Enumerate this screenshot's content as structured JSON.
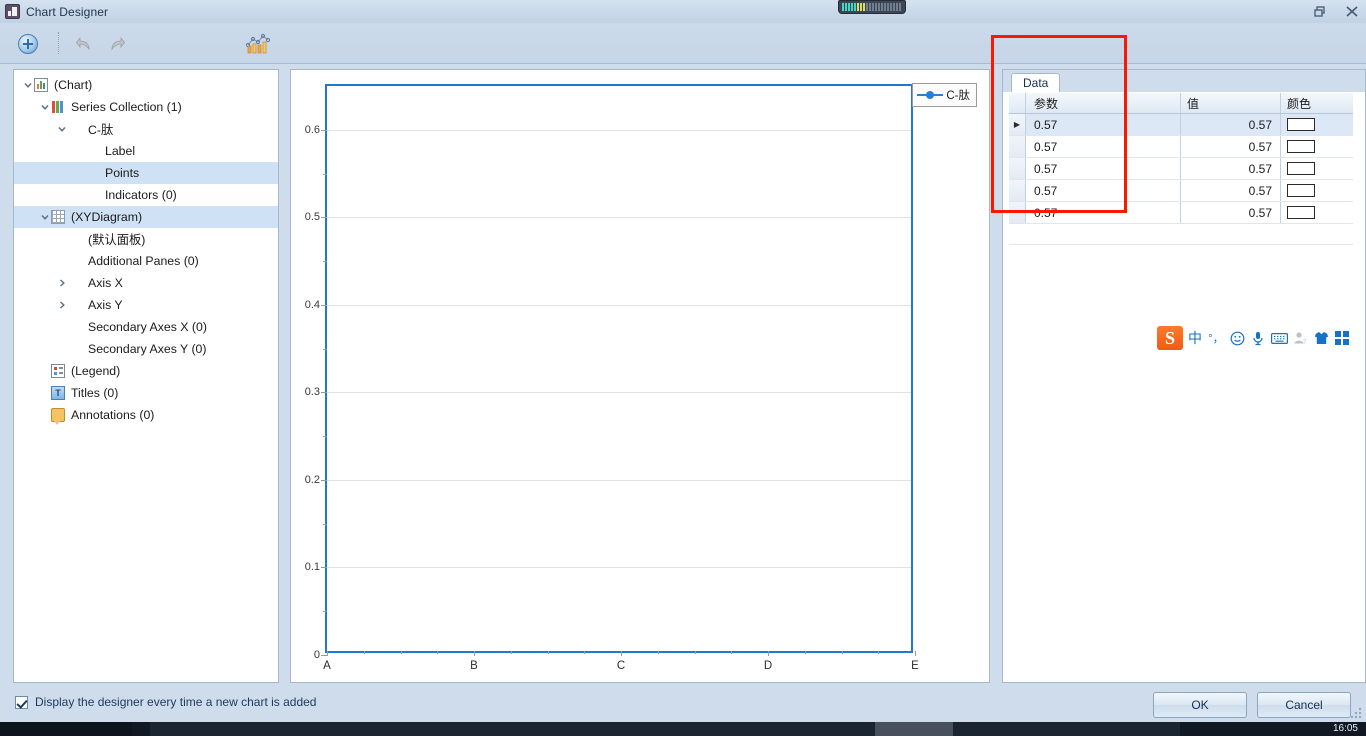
{
  "window": {
    "title": "Chart Designer",
    "icon": "chart-designer-icon",
    "restore_icon": "restore-window-icon",
    "close_icon": "close-window-icon"
  },
  "toolbar": {
    "add_label": "",
    "add_icon": "add-circle-icon",
    "undo_icon": "undo-arrow-icon",
    "redo_icon": "redo-arrow-icon",
    "chart_type_icon": "chart-type-icon"
  },
  "tree": {
    "items": [
      {
        "label": "(Chart)",
        "indent": 0,
        "chevron": "down",
        "icon": "chart-icon",
        "selected": false
      },
      {
        "label": "Series Collection (1)",
        "indent": 1,
        "chevron": "down",
        "icon": "series-icon",
        "selected": false
      },
      {
        "label": "C-肽",
        "indent": 2,
        "chevron": "down",
        "icon": "none",
        "selected": false
      },
      {
        "label": "Label",
        "indent": 3,
        "chevron": "none",
        "icon": "none",
        "selected": false
      },
      {
        "label": "Points",
        "indent": 3,
        "chevron": "none",
        "icon": "none",
        "selected": true
      },
      {
        "label": "Indicators (0)",
        "indent": 3,
        "chevron": "none",
        "icon": "none",
        "selected": false
      },
      {
        "label": "(XYDiagram)",
        "indent": 1,
        "chevron": "down",
        "icon": "grid-icon",
        "selected": true
      },
      {
        "label": "(默认面板)",
        "indent": 2,
        "chevron": "none",
        "icon": "none",
        "selected": false
      },
      {
        "label": "Additional Panes (0)",
        "indent": 2,
        "chevron": "none",
        "icon": "none",
        "selected": false
      },
      {
        "label": "Axis X",
        "indent": 2,
        "chevron": "right",
        "icon": "none",
        "selected": false
      },
      {
        "label": "Axis Y",
        "indent": 2,
        "chevron": "right",
        "icon": "none",
        "selected": false
      },
      {
        "label": "Secondary Axes X (0)",
        "indent": 2,
        "chevron": "none",
        "icon": "none",
        "selected": false
      },
      {
        "label": "Secondary Axes Y (0)",
        "indent": 2,
        "chevron": "none",
        "icon": "none",
        "selected": false
      },
      {
        "label": "(Legend)",
        "indent": 1,
        "chevron": "none",
        "icon": "legend-icon",
        "selected": false
      },
      {
        "label": "Titles (0)",
        "indent": 1,
        "chevron": "none",
        "icon": "title-icon",
        "selected": false
      },
      {
        "label": "Annotations (0)",
        "indent": 1,
        "chevron": "none",
        "icon": "annotation-icon",
        "selected": false
      }
    ]
  },
  "chart_data": {
    "type": "line",
    "title": "",
    "xlabel": "",
    "ylabel": "",
    "categories": [
      "A",
      "B",
      "C",
      "D",
      "E"
    ],
    "series": [
      {
        "name": "C-肽",
        "values": [],
        "color": "#2a7fd4",
        "marker": "circle"
      }
    ],
    "ylim": [
      0,
      0.65
    ],
    "ytick_labels": [
      "0",
      "0.1",
      "0.2",
      "0.3",
      "0.4",
      "0.5",
      "0.6"
    ],
    "ytick_values": [
      0,
      0.1,
      0.2,
      0.3,
      0.4,
      0.5,
      0.6
    ],
    "yminor_values": [
      0.05,
      0.15,
      0.25,
      0.35,
      0.45,
      0.55
    ],
    "grid": true,
    "legend_position": "top-right",
    "legend_entries": [
      "C-肽"
    ],
    "plot_border_color": "#1e7ad0"
  },
  "data_panel": {
    "tab_label": "Data",
    "columns": [
      "参数",
      "值",
      "颜色"
    ],
    "rows": [
      {
        "param": "0.57",
        "value": "0.57",
        "color": "#ffffff",
        "selected": true
      },
      {
        "param": "0.57",
        "value": "0.57",
        "color": "#ffffff",
        "selected": false
      },
      {
        "param": "0.57",
        "value": "0.57",
        "color": "#ffffff",
        "selected": false
      },
      {
        "param": "0.57",
        "value": "0.57",
        "color": "#ffffff",
        "selected": false
      },
      {
        "param": "0.57",
        "value": "0.57",
        "color": "#ffffff",
        "selected": false
      }
    ],
    "highlight_color": "#fb1800"
  },
  "ime": {
    "logo": "S",
    "items": [
      {
        "glyph": "中",
        "name": "chinese-mode-icon",
        "gray": false
      },
      {
        "glyph": "°，",
        "name": "punctuation-mode-icon",
        "gray": false
      },
      {
        "glyph": "☺",
        "name": "emoji-icon",
        "gray": false
      },
      {
        "glyph": "Ἲ4",
        "name": "microphone-icon",
        "gray": false
      },
      {
        "glyph": "⌨",
        "name": "soft-keyboard-icon",
        "gray": false
      },
      {
        "glyph": "♟",
        "name": "user-icon",
        "gray": true
      },
      {
        "glyph": "ὅ5",
        "name": "skin-icon",
        "gray": false
      }
    ],
    "toolbox_icon": "toolbox-grid-icon"
  },
  "footer": {
    "checkbox_label": "Display the designer every time a new chart is added",
    "checkbox_checked": true,
    "ok_label": "OK",
    "cancel_label": "Cancel"
  },
  "taskbar": {
    "clock": "16:05"
  }
}
